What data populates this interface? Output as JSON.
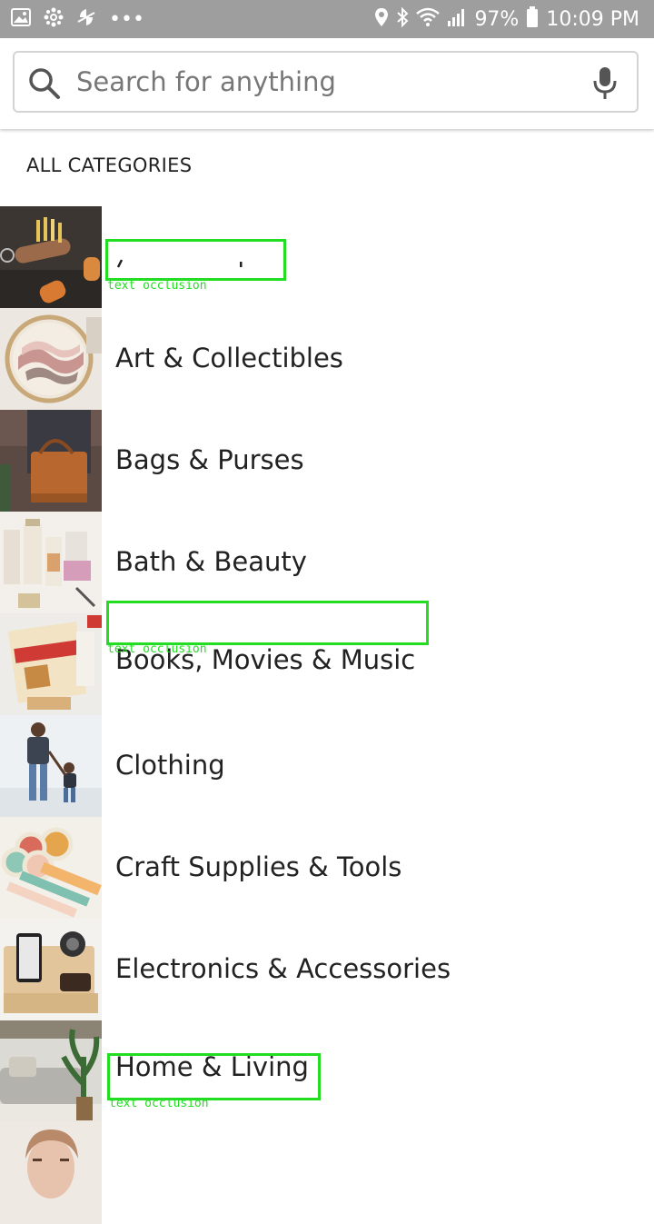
{
  "status_bar": {
    "overflow_dots": "•••",
    "battery_percent": "97%",
    "time": "10:09 PM",
    "icons": [
      "image-icon",
      "pinwheel-icon",
      "sync-icon",
      "location-icon",
      "bluetooth-icon",
      "wifi-icon",
      "signal-icon",
      "battery-icon"
    ]
  },
  "search": {
    "placeholder": "Search for anything",
    "icon": "search-icon",
    "voice_icon": "microphone-icon"
  },
  "section_title": "ALL CATEGORIES",
  "categories": [
    {
      "label": "",
      "image": "leather-key-organizers",
      "occluded": true
    },
    {
      "label": "Art & Collectibles",
      "image": "embroidery-hoop"
    },
    {
      "label": "Bags & Purses",
      "image": "leather-tote-bag"
    },
    {
      "label": "Bath & Beauty",
      "image": "cosmetic-jars"
    },
    {
      "label": "Books, Movies & Music",
      "image": "michigan-poster",
      "occluded": true
    },
    {
      "label": "Clothing",
      "image": "father-and-child"
    },
    {
      "label": "Craft Supplies & Tools",
      "image": "washi-tape-rolls"
    },
    {
      "label": "Electronics & Accessories",
      "image": "wooden-phone-dock"
    },
    {
      "label": "Home & Living",
      "image": "living-room-plant",
      "occluded": true
    },
    {
      "label": "",
      "image": "woman-portrait"
    }
  ],
  "occlusion_tag": "text occlusion",
  "colors": {
    "status_bar": "#9e9e9e",
    "occlusion_box": "#22dd22",
    "text": "#222222"
  }
}
